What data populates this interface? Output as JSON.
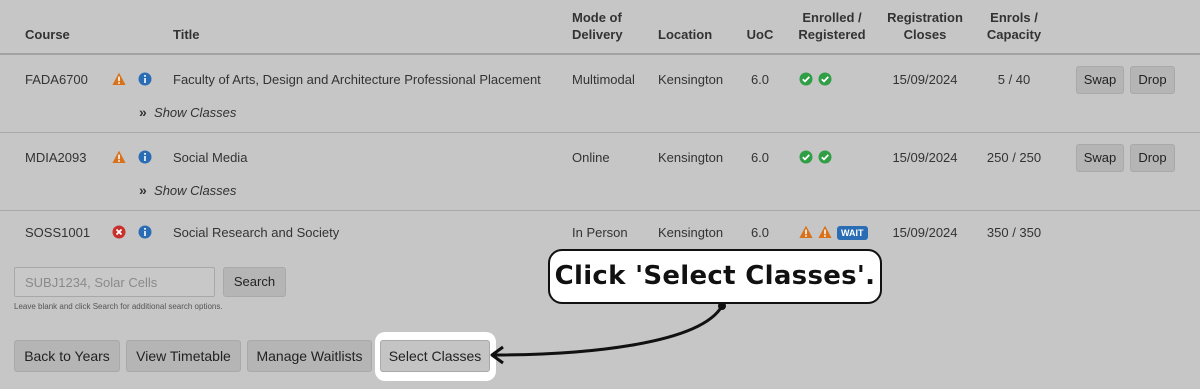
{
  "table": {
    "headers": {
      "course": "Course",
      "title": "Title",
      "mode_line1": "Mode of",
      "mode_line2": "Delivery",
      "location": "Location",
      "uoc": "UoC",
      "enrolled_line1": "Enrolled /",
      "enrolled_line2": "Registered",
      "reg_line1": "Registration",
      "reg_line2": "Closes",
      "enrols_line1": "Enrols /",
      "enrols_line2": "Capacity"
    },
    "rows": [
      {
        "course": "FADA6700",
        "status_icon": "warning-icon",
        "title": "Faculty of Arts, Design and Architecture Professional Placement",
        "mode": "Multimodal",
        "location": "Kensington",
        "uoc": "6.0",
        "reg_icons": [
          "check-circle-icon",
          "check-circle-icon"
        ],
        "closes": "15/09/2024",
        "capacity": "5 / 40",
        "show_classes": "Show Classes",
        "swap": "Swap",
        "drop": "Drop"
      },
      {
        "course": "MDIA2093",
        "status_icon": "warning-icon",
        "title": "Social Media",
        "mode": "Online",
        "location": "Kensington",
        "uoc": "6.0",
        "reg_icons": [
          "check-circle-icon",
          "check-circle-icon"
        ],
        "closes": "15/09/2024",
        "capacity": "250 / 250",
        "show_classes": "Show Classes",
        "swap": "Swap",
        "drop": "Drop"
      },
      {
        "course": "SOSS1001",
        "status_icon": "error-circle-icon",
        "title": "Social Research and Society",
        "mode": "In Person",
        "location": "Kensington",
        "uoc": "6.0",
        "reg_icons": [
          "warning-icon",
          "warning-icon"
        ],
        "wait_badge": "WAIT",
        "closes": "15/09/2024",
        "capacity": "350 / 350"
      }
    ]
  },
  "search": {
    "placeholder": "SUBJ1234, Solar Cells",
    "value": "",
    "button": "Search",
    "hint": "Leave blank and click Search for additional search options."
  },
  "actions": {
    "back": "Back to Years",
    "timetable": "View Timetable",
    "waitlists": "Manage Waitlists",
    "select": "Select Classes"
  },
  "annotation": {
    "text": "Click 'Select Classes'."
  },
  "colors": {
    "warning": "#d9711a",
    "info": "#2a6db4",
    "success": "#2f9e44",
    "error": "#c9302c",
    "background": "#c6c6c6"
  }
}
